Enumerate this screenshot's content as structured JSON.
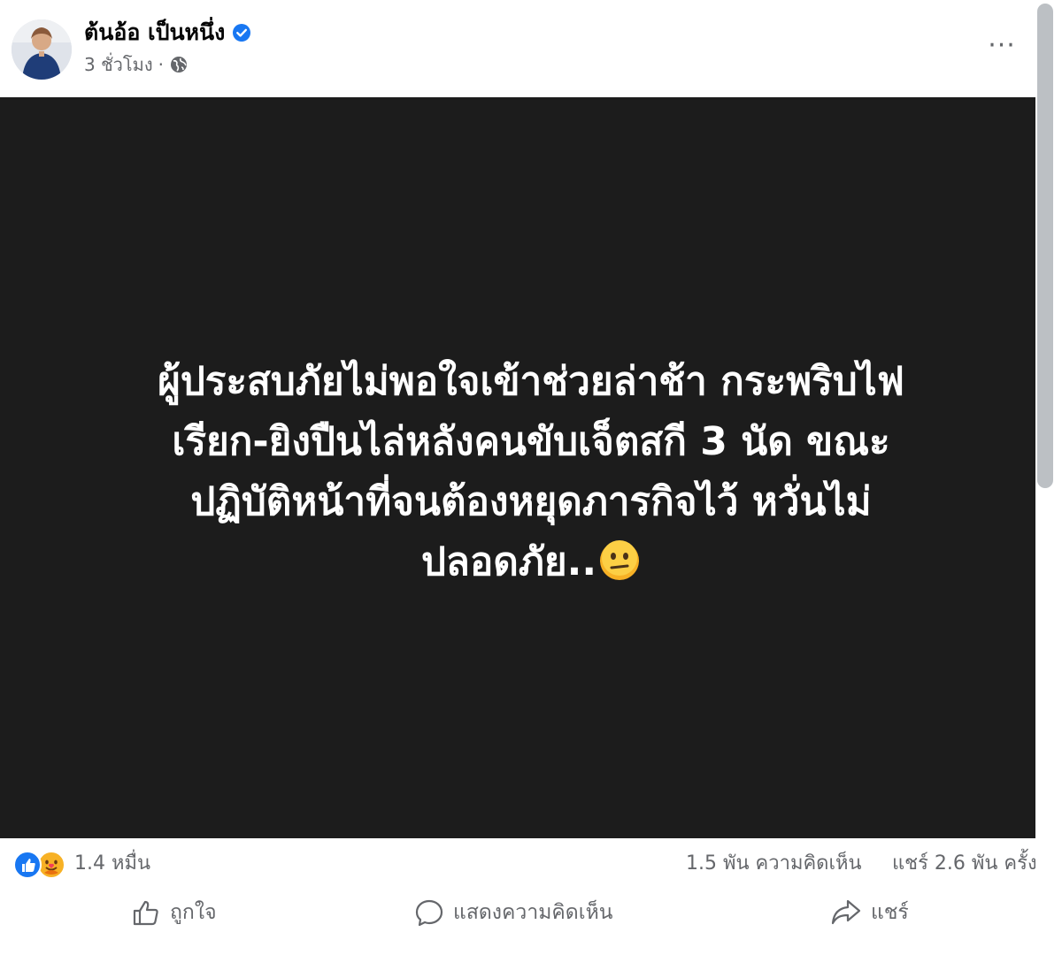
{
  "post": {
    "author": "ต้นอ้อ เป็นหนึ่ง",
    "time": "3 ชั่วโมง",
    "separator": "·",
    "text": "ผู้ประสบภัยไม่พอใจเข้าช่วยล่าช้า กระพริบไฟ\nเรียก-ยิงปืนไล่หลังคนขับเจ็ตสกี 3 นัด ขณะ\nปฏิบัติหน้าที่จนต้องหยุดภารกิจไว้ หวั่นไม่\nปลอดภัย.."
  },
  "icons": {
    "verified": "verified-badge-icon",
    "privacy": "globe-icon",
    "more": "more-options-icon",
    "emoji": "confused-face-emoji",
    "reactions": [
      "like-reaction-icon",
      "care-reaction-icon"
    ]
  },
  "stats": {
    "reactions": "1.4 หมื่น",
    "comments": "1.5 พัน ความคิดเห็น",
    "shares": "แชร์ 2.6 พัน ครั้ง"
  },
  "actions": {
    "like": "ถูกใจ",
    "comment": "แสดงความคิดเห็น",
    "share": "แชร์"
  },
  "colors": {
    "post_background": "#1c1c1c",
    "post_text": "#ffffff",
    "meta_text": "#65676b",
    "verified_blue": "#1877f2",
    "like_blue": "#1877f2",
    "care_yellow": "#f7b125"
  }
}
